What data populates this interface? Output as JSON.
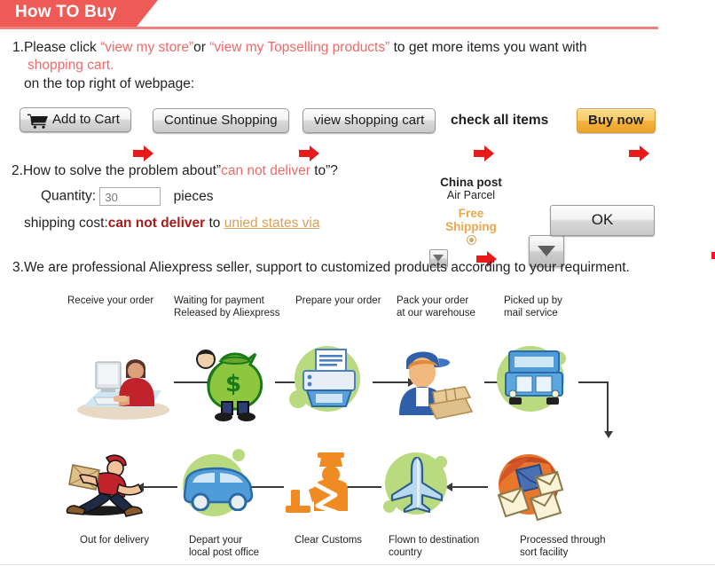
{
  "header": {
    "title": "How TO Buy",
    "tab_color": "#ee5b57",
    "rule_color": "#ef7f7b"
  },
  "section1": {
    "number": "1.",
    "line1_a": "Please click ",
    "link1": "“view my store”",
    "line1_b": "or ",
    "link2": "“view my Topselling products”",
    "line1_c": " to get more items you want with",
    "line2_highlight": "shopping cart.",
    "line3": "on the top right of webpage:",
    "highlight_color": "#ef6a68",
    "buttons": [
      {
        "label": "Add to Cart",
        "icon": "shopping-cart-icon",
        "style": "gray"
      },
      {
        "label": "Continue Shopping",
        "style": "gray"
      },
      {
        "label": "view shopping cart",
        "style": "gray"
      },
      {
        "label": "check all items",
        "style": "text"
      },
      {
        "label": "Buy now",
        "style": "orange"
      }
    ]
  },
  "section2": {
    "number": "2.",
    "heading_a": "How to solve the problem about”",
    "heading_highlight": "can not deliver",
    "heading_b": " to”?",
    "quantity_label": "Quantity:",
    "quantity_value": "30",
    "quantity_unit": "pieces",
    "shipping_label": "shipping cost:",
    "shipping_error": "can not deliver",
    "shipping_to": " to ",
    "country": "unied states via",
    "country_color": "#d9a05b",
    "error_color": "#a61b1b",
    "china_post": {
      "title": "China post",
      "subtitle": "Air Parcel",
      "free_shipping_line1": "Free",
      "free_shipping_line2": "Shipping",
      "free_shipping_color": "#e8a84e"
    },
    "ok_button": "OK"
  },
  "section3": {
    "number": "3.",
    "text": "We are professional Aliexpress seller, support to customized products according to your requirment."
  },
  "flow": {
    "top_row": [
      {
        "label": "Receive your order",
        "icon": "person-at-computer-icon"
      },
      {
        "label": "Waiting for payment\nReleased by Aliexpress",
        "icon": "money-bag-icon"
      },
      {
        "label": "Prepare your order",
        "icon": "printer-icon"
      },
      {
        "label": "Pack your order\nat our warehouse",
        "icon": "warehouse-worker-icon"
      },
      {
        "label": "Picked up by\nmail service",
        "icon": "mail-truck-icon"
      }
    ],
    "bottom_row": [
      {
        "label": "Out for delivery",
        "icon": "running-courier-icon"
      },
      {
        "label": "Depart your\nlocal post office",
        "icon": "delivery-van-icon"
      },
      {
        "label": "Clear Customs",
        "icon": "customs-officer-icon"
      },
      {
        "label": "Flown to destination\ncountry",
        "icon": "airplane-icon"
      },
      {
        "label": "Processed through\nsort facility",
        "icon": "mail-sorting-icon"
      }
    ],
    "blob_color": "#b9da7e",
    "arrow_color": "#3a3a3a"
  }
}
